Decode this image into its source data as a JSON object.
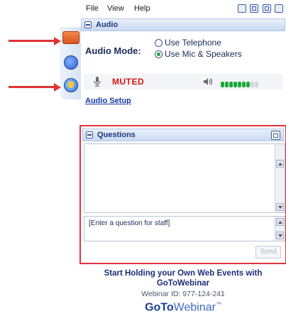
{
  "menu": {
    "file": "File",
    "view": "View",
    "help": "Help"
  },
  "audio_panel": {
    "title": "Audio",
    "mode_label": "Audio Mode:",
    "options": [
      {
        "label": "Use Telephone",
        "selected": false
      },
      {
        "label": "Use Mic & Speakers",
        "selected": true
      }
    ],
    "muted_text": "MUTED",
    "mic_level": {
      "lit": 7,
      "total": 9
    },
    "setup_link": "Audio Setup"
  },
  "questions_panel": {
    "title": "Questions",
    "input_placeholder": "[Enter a question for staff]",
    "send_label": "Send"
  },
  "promo": {
    "line1": "Start Holding your Own Web Events with",
    "line2": "GoToWebinar",
    "webinar_id": "Webinar ID: 977-124-241",
    "brand_bold": "GoTo",
    "brand_rest": "Webinar",
    "brand_tm": "™"
  },
  "colors": {
    "annotation_red": "#e03434",
    "muted_red": "#d21414",
    "level_green": "#1da83a",
    "link_blue": "#1438a8"
  }
}
